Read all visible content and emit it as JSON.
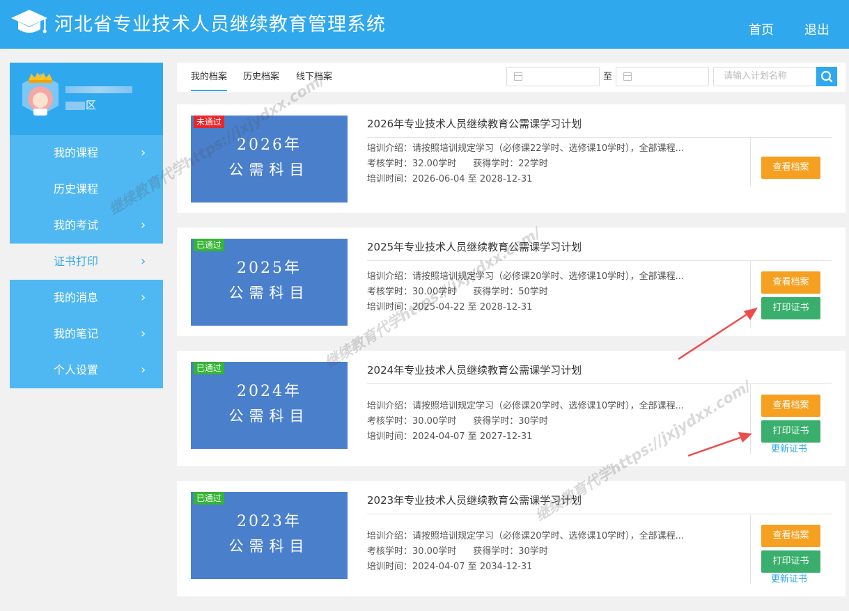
{
  "header": {
    "title": "河北省专业技术人员继续教育管理系统",
    "nav": {
      "home": "首页",
      "logout": "退出"
    }
  },
  "sidebar": {
    "profile": {
      "area": "区"
    },
    "items": [
      {
        "label": "我的课程",
        "chev": "›"
      },
      {
        "label": "历史课程",
        "chev": ""
      },
      {
        "label": "我的考试",
        "chev": "›"
      },
      {
        "label": "证书打印",
        "chev": "›"
      },
      {
        "label": "我的消息",
        "chev": "›"
      },
      {
        "label": "我的笔记",
        "chev": "›"
      },
      {
        "label": "个人设置",
        "chev": "›"
      }
    ]
  },
  "tabs": [
    "我的档案",
    "历史档案",
    "线下档案"
  ],
  "filter": {
    "to": "至",
    "search_placeholder": "请输入计划名称"
  },
  "cards": [
    {
      "status": "未通过",
      "thumb_year": "2026年",
      "thumb_subject": "公需科目",
      "title": "2026年专业技术人员继续教育公需课学习计划",
      "intro": "培训介绍：请按照培训规定学习（必修课22学时、选修课10学时），全部课程...",
      "assess": "考核学时：32.00学时",
      "earned": "获得学时：22学时",
      "time": "培训时间：2026-06-04 至 2028-12-31",
      "view": "查看档案"
    },
    {
      "status": "已通过",
      "thumb_year": "2025年",
      "thumb_subject": "公需科目",
      "title": "2025年专业技术人员继续教育公需课学习计划",
      "intro": "培训介绍：请按照培训规定学习（必修课20学时、选修课10学时），全部课程...",
      "assess": "考核学时：30.00学时",
      "earned": "获得学时：50学时",
      "time": "培训时间：2025-04-22 至 2028-12-31",
      "view": "查看档案",
      "print": "打印证书"
    },
    {
      "status": "已通过",
      "thumb_year": "2024年",
      "thumb_subject": "公需科目",
      "title": "2024年专业技术人员继续教育公需课学习计划",
      "intro": "培训介绍：请按照培训规定学习（必修课20学时、选修课10学时），全部课程...",
      "assess": "考核学时：30.00学时",
      "earned": "获得学时：30学时",
      "time": "培训时间：2024-04-07 至 2027-12-31",
      "view": "查看档案",
      "print": "打印证书",
      "update": "更新证书"
    },
    {
      "status": "已通过",
      "thumb_year": "2023年",
      "thumb_subject": "公需科目",
      "title": "2023年专业技术人员继续教育公需课学习计划",
      "intro": "培训介绍：请按照培训规定学习（必修课20学时、选修课10学时），全部课程...",
      "assess": "考核学时：30.00学时",
      "earned": "获得学时：30学时",
      "time": "培训时间：2024-04-07 至 2034-12-31",
      "view": "查看档案",
      "print": "打印证书",
      "update": "更新证书"
    }
  ],
  "watermark": {
    "text_a": "继续教育代学https://jxjydxx.com/",
    "text_b": "继续教育代学https://jxjydxx.com/",
    "text_c": "继续教育代学https://jxjydxx.com/"
  },
  "colors": {
    "header": "#2fa8ee",
    "thumb": "#4a7fcc",
    "orange": "#f5a020",
    "green": "#3aaf6d",
    "fail": "#e8262b",
    "pass": "#34b534"
  },
  "icons": {
    "logo": "graduation-cap-icon",
    "calendar": "calendar-icon",
    "search": "search-icon"
  }
}
